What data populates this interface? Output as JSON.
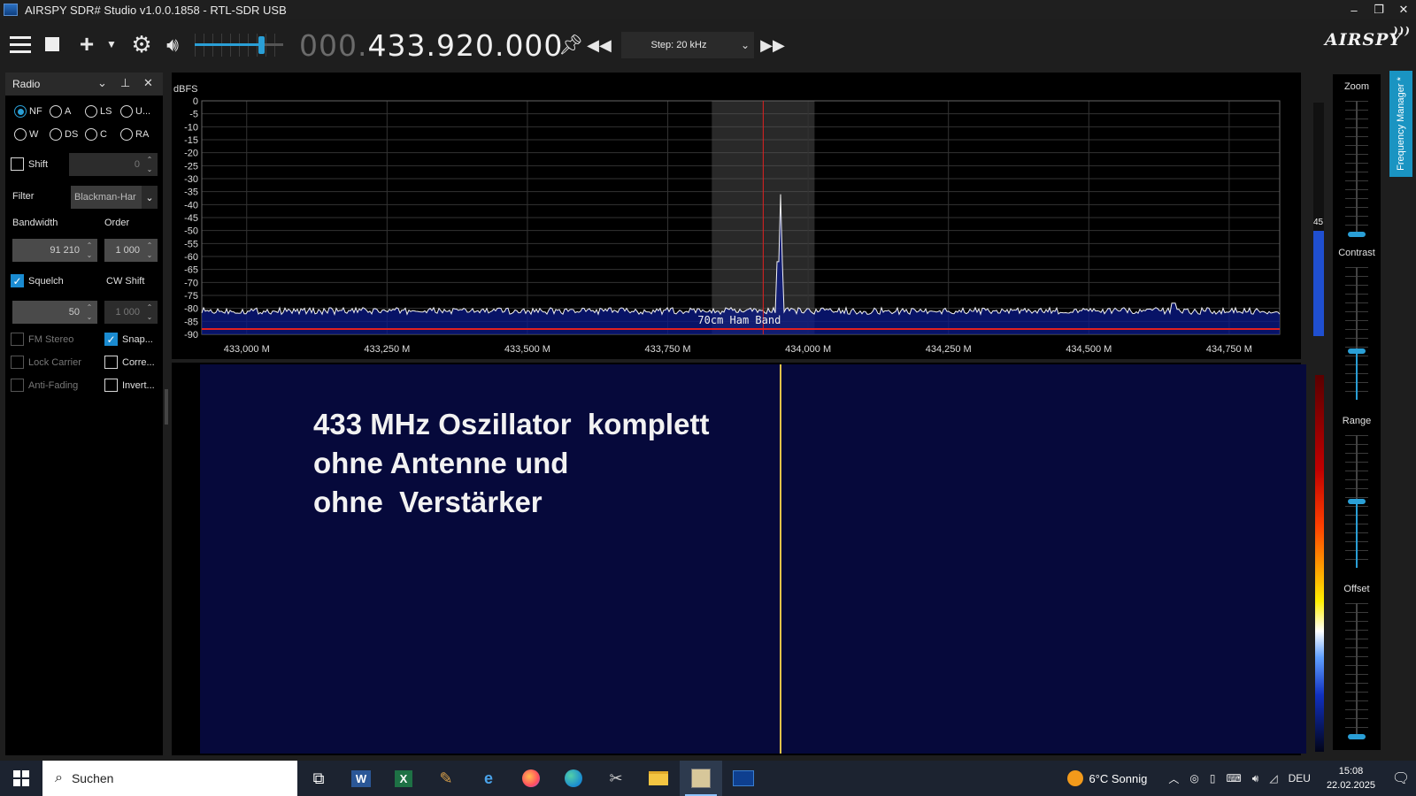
{
  "window": {
    "title": "AIRSPY SDR# Studio v1.0.0.1858 - RTL-SDR USB",
    "controls": [
      "–",
      "❐",
      "✕"
    ]
  },
  "toolbar": {
    "frequency_dim": "000.",
    "frequency_lit": "433.920.000",
    "step_label": "Step: 20 kHz",
    "volume": 0.75,
    "logo": "AIRSPY"
  },
  "radio_panel": {
    "title": "Radio",
    "modes": [
      "NF",
      "A",
      "LS",
      "U...",
      "W",
      "DS",
      "C",
      "RA"
    ],
    "selected_mode": "NF",
    "shift_label": "Shift",
    "shift_value": "0",
    "filter_label": "Filter",
    "filter_value": "Blackman-Har",
    "bandwidth_label": "Bandwidth",
    "bandwidth_value": "91 210",
    "order_label": "Order",
    "order_value": "1 000",
    "squelch_label": "Squelch",
    "squelch_value": "50",
    "cw_shift_label": "CW Shift",
    "cw_shift_value": "1 000",
    "fm_stereo_label": "FM Stereo",
    "snap_label": "Snap...",
    "lock_carrier_label": "Lock Carrier",
    "correct_label": "Corre...",
    "anti_fading_label": "Anti-Fading",
    "invert_label": "Invert..."
  },
  "spectrum": {
    "y_unit": "dBFS",
    "y_ticks": [
      "0",
      "-5",
      "-10",
      "-15",
      "-20",
      "-25",
      "-30",
      "-35",
      "-40",
      "-45",
      "-50",
      "-55",
      "-60",
      "-65",
      "-70",
      "-75",
      "-80",
      "-85",
      "-90"
    ],
    "x_ticks": [
      "433,000 M",
      "433,250 M",
      "433,500 M",
      "433,750 M",
      "434,000 M",
      "434,250 M",
      "434,500 M",
      "434,750 M"
    ],
    "band_label": "70cm Ham Band",
    "level_value": "45",
    "level_fraction": 0.45,
    "noise_floor_dbfs": -81,
    "peak_dbfs": -36,
    "peak_freq_mhz": 433.92
  },
  "waterfall": {
    "annotation_line1": "433 MHz Oszillator  komplett",
    "annotation_line2": "ohne Antenne und",
    "annotation_line3": "ohne  Verstärker"
  },
  "right_panel": {
    "zoom_label": "Zoom",
    "contrast_label": "Contrast",
    "range_label": "Range",
    "offset_label": "Offset",
    "frequency_manager_label": "Frequency Manager *"
  },
  "taskbar": {
    "search_placeholder": "Suchen",
    "weather": "6°C  Sonnig",
    "language": "DEU",
    "time": "15:08",
    "date": "22.02.2025"
  }
}
